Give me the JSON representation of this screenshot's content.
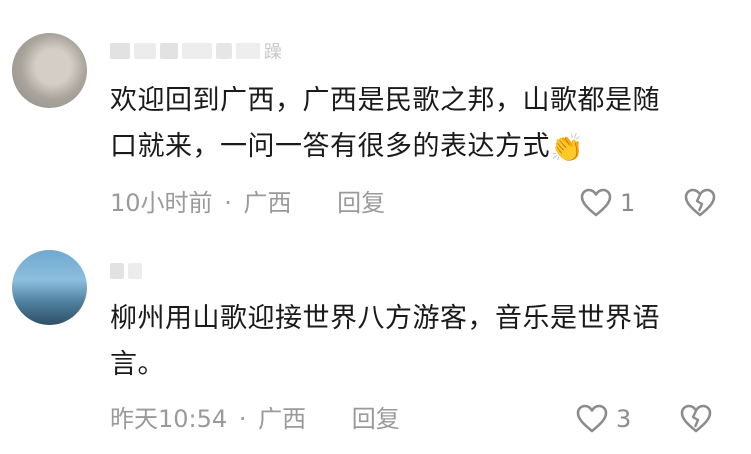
{
  "comments": [
    {
      "username_suffix": "躁",
      "text_line1": "欢迎回到广西，广西是民歌之邦，山歌都是随",
      "text_line2": "口就来，一问一答有很多的表达方式",
      "emoji": "👏",
      "time": "10小时前",
      "separator": "·",
      "location": "广西",
      "reply_label": "回复",
      "like_count": "1"
    },
    {
      "username_suffix": "",
      "text_line1": "柳州用山歌迎接世界八方游客，音乐是世界语",
      "text_line2": "言。",
      "time": "昨天10:54",
      "separator": "·",
      "location": "广西",
      "reply_label": "回复",
      "like_count": "3"
    }
  ],
  "icons": {
    "like": "heart-outline-icon",
    "dislike": "broken-heart-icon"
  },
  "colors": {
    "text": "#1a1a1a",
    "meta": "#9a9a9a",
    "icon": "#8c8c8c"
  }
}
